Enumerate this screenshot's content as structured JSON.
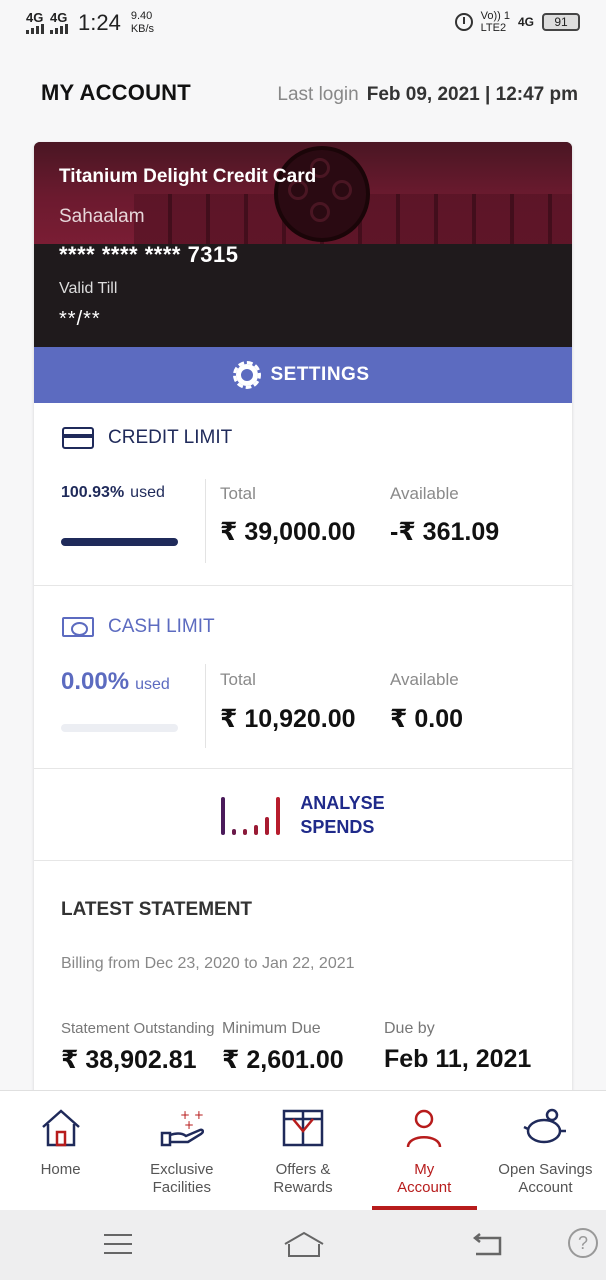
{
  "status_bar": {
    "network1": "4G",
    "network2": "4G",
    "time": "1:24",
    "speed_value": "9.40",
    "speed_unit": "KB/s",
    "volte": "Vo)) 1",
    "lte": "LTE2",
    "network3": "4G",
    "battery": "91"
  },
  "header": {
    "title": "MY ACCOUNT",
    "last_login_label": "Last login",
    "last_login_value": "Feb 09, 2021 | 12:47 pm"
  },
  "card": {
    "name": "Titanium Delight Credit Card",
    "holder": "Sahaalam",
    "number": "**** **** **** 7315",
    "valid_label": "Valid Till",
    "valid_value": "**/**"
  },
  "settings": {
    "label": "SETTINGS",
    "icon": "gear-icon"
  },
  "credit_limit": {
    "title": "CREDIT LIMIT",
    "icon": "credit-card-icon",
    "used_pct": "100.93%",
    "used_label": "used",
    "used_fraction": 1.0,
    "total_label": "Total",
    "total_value": "₹ 39,000.00",
    "available_label": "Available",
    "available_value": "-₹ 361.09"
  },
  "cash_limit": {
    "title": "CASH LIMIT",
    "icon": "cash-icon",
    "used_pct": "0.00%",
    "used_label": "used",
    "used_fraction": 0.0,
    "total_label": "Total",
    "total_value": "₹ 10,920.00",
    "available_label": "Available",
    "available_value": "₹ 0.00"
  },
  "analyse": {
    "line1": "ANALYSE",
    "line2": "SPENDS",
    "icon": "analyse-spends-icon"
  },
  "statement": {
    "title": "LATEST STATEMENT",
    "billing": "Billing from Dec 23, 2020  to  Jan 22, 2021",
    "outstanding_label": "Statement Outstanding",
    "outstanding_value": "₹ 38,902.81",
    "min_due_label": "Minimum Due",
    "min_due_value": "₹ 2,601.00",
    "due_by_label": "Due by",
    "due_by_value": "Feb 11, 2021"
  },
  "bottom_nav": {
    "items": [
      {
        "label": "Home",
        "icon": "home-icon"
      },
      {
        "label": "Exclusive\nFacilities",
        "icon": "exclusive-facilities-icon"
      },
      {
        "label": "Offers &\nRewards",
        "icon": "gift-icon"
      },
      {
        "label": "My\nAccount",
        "icon": "user-icon"
      },
      {
        "label": "Open Savings\nAccount",
        "icon": "piggy-bank-icon"
      }
    ],
    "active_index": 3
  },
  "colors": {
    "primary_navy": "#1f2a5a",
    "accent_blue": "#5c6bc0",
    "active_red": "#b71c1c",
    "card_maroon": "#6c1a2f"
  }
}
